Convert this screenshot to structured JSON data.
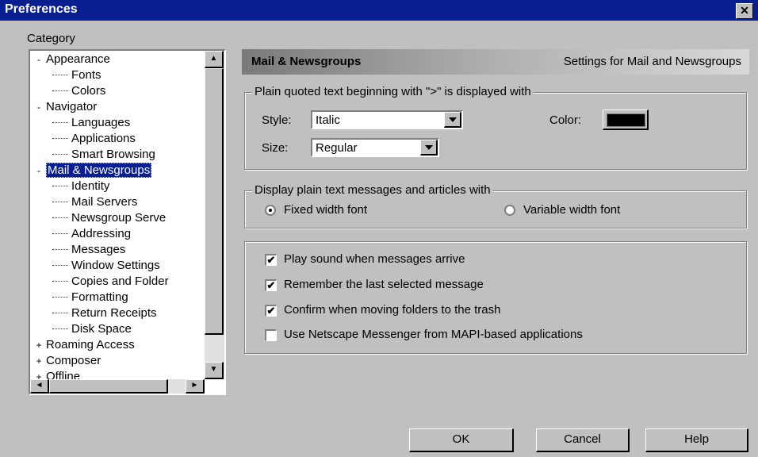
{
  "window": {
    "title": "Preferences",
    "close_glyph": "✕"
  },
  "category_label": "Category",
  "tree": [
    {
      "label": "Appearance",
      "level": 0,
      "expander": "-"
    },
    {
      "label": "Fonts",
      "level": 1
    },
    {
      "label": "Colors",
      "level": 1
    },
    {
      "label": "Navigator",
      "level": 0,
      "expander": "-"
    },
    {
      "label": "Languages",
      "level": 1
    },
    {
      "label": "Applications",
      "level": 1
    },
    {
      "label": "Smart Browsing",
      "level": 1
    },
    {
      "label": "Mail & Newsgroups",
      "level": 0,
      "expander": "-",
      "selected": true
    },
    {
      "label": "Identity",
      "level": 1
    },
    {
      "label": "Mail Servers",
      "level": 1
    },
    {
      "label": "Newsgroup Serve",
      "level": 1
    },
    {
      "label": "Addressing",
      "level": 1
    },
    {
      "label": "Messages",
      "level": 1
    },
    {
      "label": "Window Settings",
      "level": 1
    },
    {
      "label": "Copies and Folder",
      "level": 1
    },
    {
      "label": "Formatting",
      "level": 1
    },
    {
      "label": "Return Receipts",
      "level": 1
    },
    {
      "label": "Disk Space",
      "level": 1
    },
    {
      "label": "Roaming Access",
      "level": 0,
      "expander": "+"
    },
    {
      "label": "Composer",
      "level": 0,
      "expander": "+"
    },
    {
      "label": "Offline",
      "level": 0,
      "expander": "+"
    }
  ],
  "header": {
    "title": "Mail & Newsgroups",
    "description": "Settings for Mail and Newsgroups"
  },
  "quoted": {
    "caption": "Plain quoted text beginning with \">\" is displayed with",
    "style_label": "Style:",
    "style_value": "Italic",
    "size_label": "Size:",
    "size_value": "Regular",
    "color_label": "Color:",
    "color_value": "#000000"
  },
  "display": {
    "caption": "Display plain text messages and articles with",
    "fixed_label": "Fixed width font",
    "variable_label": "Variable width font",
    "selected": "fixed"
  },
  "options": [
    {
      "label": "Play sound when messages arrive",
      "checked": true
    },
    {
      "label": "Remember the last selected message",
      "checked": true
    },
    {
      "label": "Confirm when moving folders to the trash",
      "checked": true
    },
    {
      "label": "Use Netscape Messenger from MAPI-based applications",
      "checked": false
    }
  ],
  "buttons": {
    "ok": "OK",
    "cancel": "Cancel",
    "help": "Help"
  },
  "scroll_arrows": {
    "up": "▲",
    "down": "▼",
    "left": "◄",
    "right": "►"
  },
  "check_mark": "✔"
}
